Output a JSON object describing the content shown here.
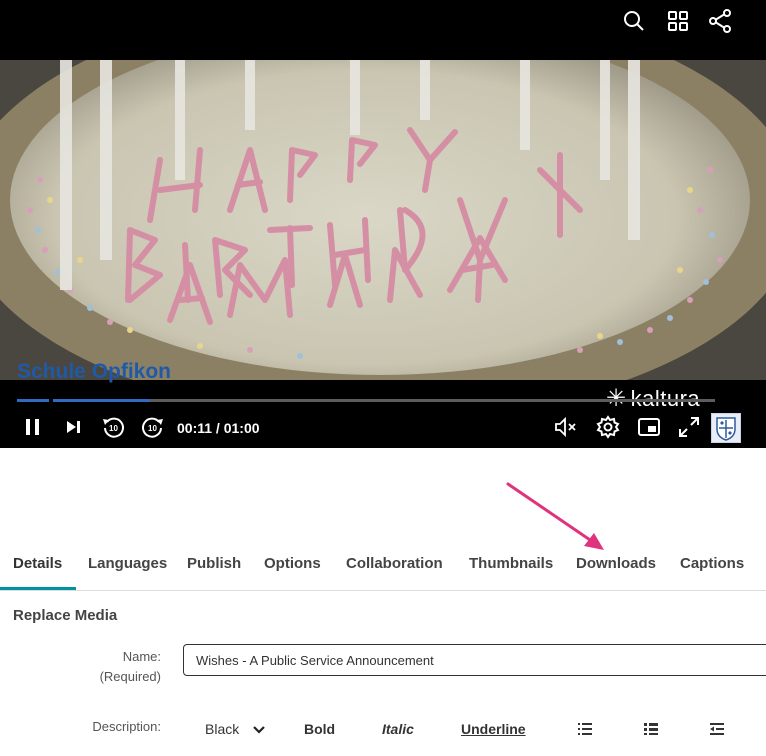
{
  "player": {
    "overlay_title": "Schule Opfikon",
    "brand": "kaltura",
    "time_display": "00:11 / 01:00",
    "progress_fraction": 0.19,
    "top_icons": [
      "search-icon",
      "grid-icon",
      "share-icon"
    ],
    "control_icons": [
      "pause-icon",
      "next-icon",
      "rewind-10-icon",
      "forward-10-icon",
      "mute-icon",
      "settings-icon",
      "picture-in-picture-icon",
      "fullscreen-icon"
    ],
    "colors": {
      "title": "#1e5aa8",
      "progress": "#2f6cc0"
    }
  },
  "tabs": [
    {
      "label": "Details",
      "active": true
    },
    {
      "label": "Languages",
      "active": false
    },
    {
      "label": "Publish",
      "active": false
    },
    {
      "label": "Options",
      "active": false
    },
    {
      "label": "Collaboration",
      "active": false
    },
    {
      "label": "Thumbnails",
      "active": false
    },
    {
      "label": "Downloads",
      "active": false
    },
    {
      "label": "Captions",
      "active": false
    }
  ],
  "accent_color": "#00939d",
  "annotation_color": "#e0337d",
  "section": {
    "title": "Replace Media"
  },
  "form": {
    "name_label": "Name:",
    "name_required": "(Required)",
    "name_value": "Wishes - A Public Service Announcement",
    "description_label": "Description:"
  },
  "toolbar": {
    "color_value": "Black",
    "bold": "Bold",
    "italic": "Italic",
    "underline": "Underline",
    "icons": [
      "ordered-list-icon",
      "bulleted-list-icon",
      "outdent-icon"
    ]
  }
}
